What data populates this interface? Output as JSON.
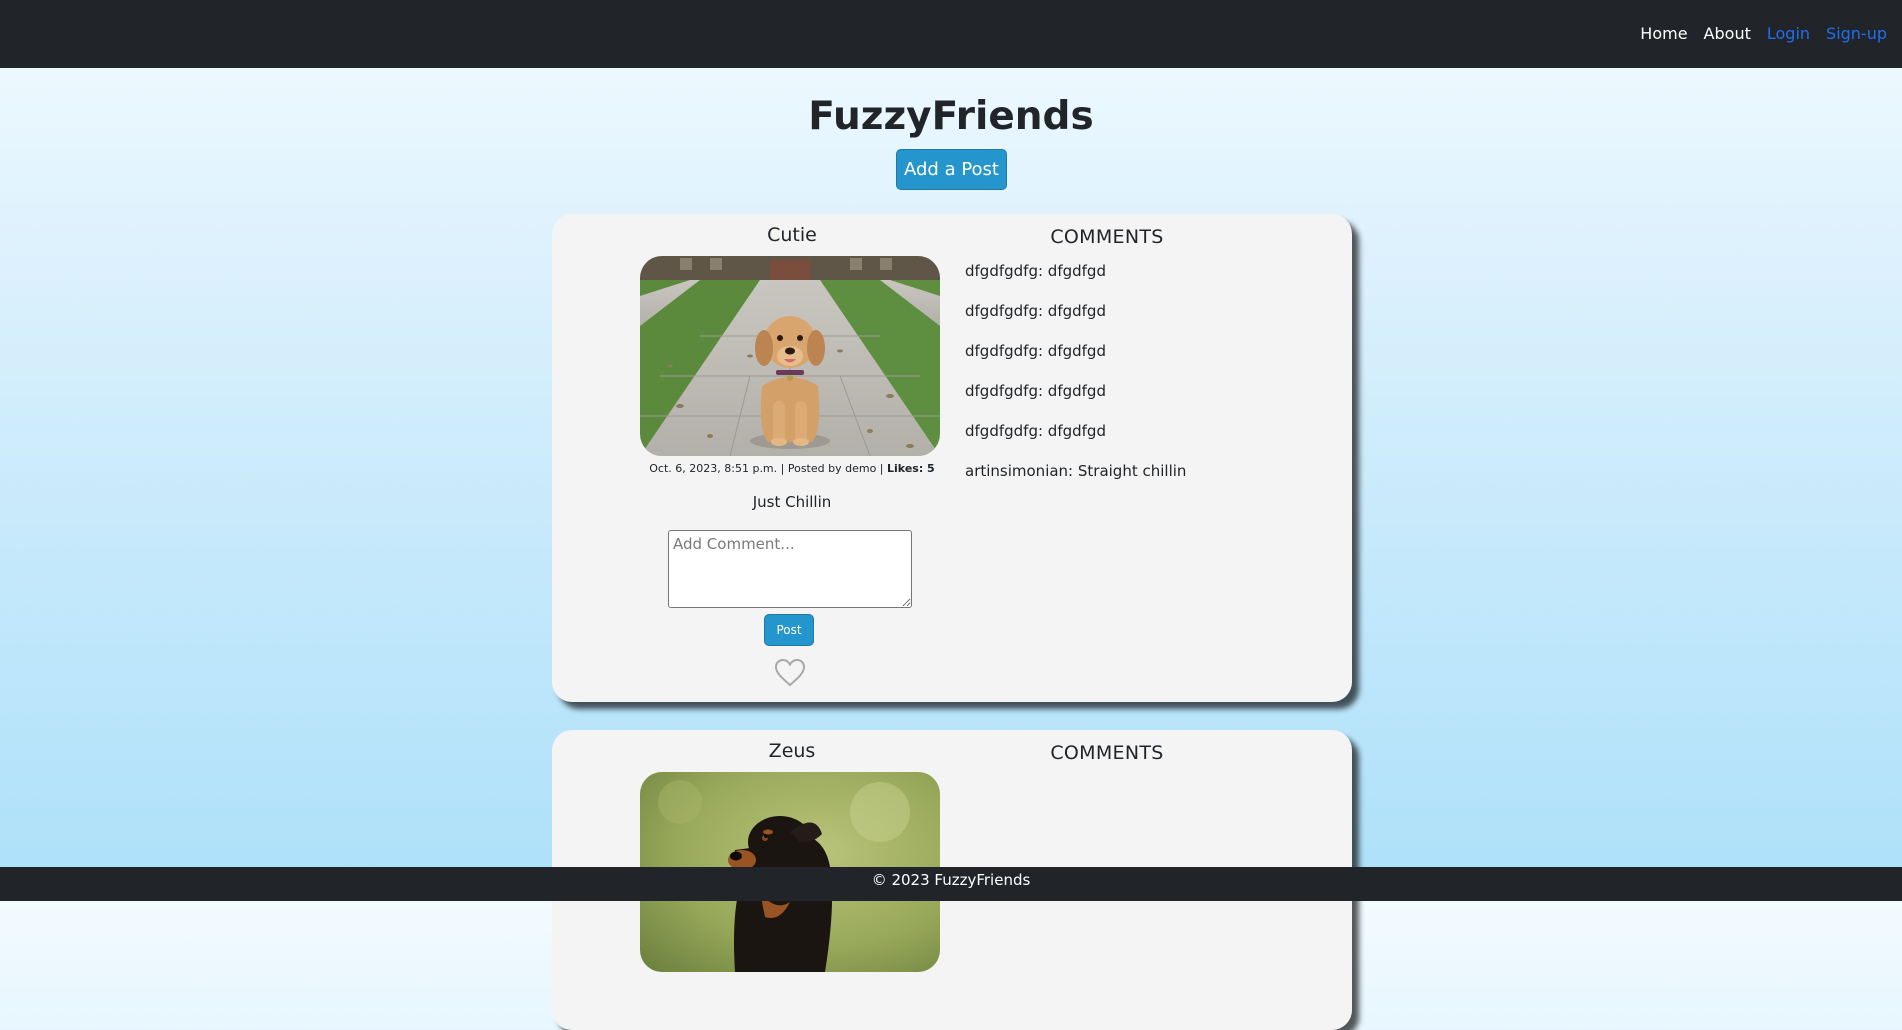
{
  "nav": {
    "links": [
      {
        "label": "Home",
        "color": "#ffffff"
      },
      {
        "label": "About",
        "color": "#ffffff"
      },
      {
        "label": "Login",
        "color": "#1f6ef0"
      },
      {
        "label": "Sign-up",
        "color": "#1f6ef0"
      }
    ]
  },
  "header": {
    "title": "FuzzyFriends",
    "add_post_label": "Add a Post"
  },
  "posts": [
    {
      "title": "Cutie",
      "image": "golden-retriever-puppy",
      "date": "Oct. 6, 2023, 8:51 p.m.",
      "posted_by": "Posted by demo",
      "likes_label": "Likes: 5",
      "caption": "Just Chillin",
      "comment_placeholder": "Add Comment...",
      "post_button_label": "Post",
      "like_icon": "heart-outline-icon",
      "comments_heading": "COMMENTS",
      "comments": [
        "dfgdfgdfg: dfgdfgd",
        "dfgdfgdfg: dfgdfgd",
        "dfgdfgdfg: dfgdfgd",
        "dfgdfgdfg: dfgdfgd",
        "dfgdfgdfg: dfgdfgd",
        "artinsimonian: Straight chillin"
      ]
    },
    {
      "title": "Zeus",
      "image": "rottweiler",
      "comments_heading": "COMMENTS",
      "comments": []
    }
  ],
  "footer": {
    "text": "© 2023 FuzzyFriends"
  },
  "colors": {
    "navbar": "#212529",
    "button": "#2596cd",
    "card": "#f4f4f4",
    "link_blue": "#1f6ef0"
  }
}
